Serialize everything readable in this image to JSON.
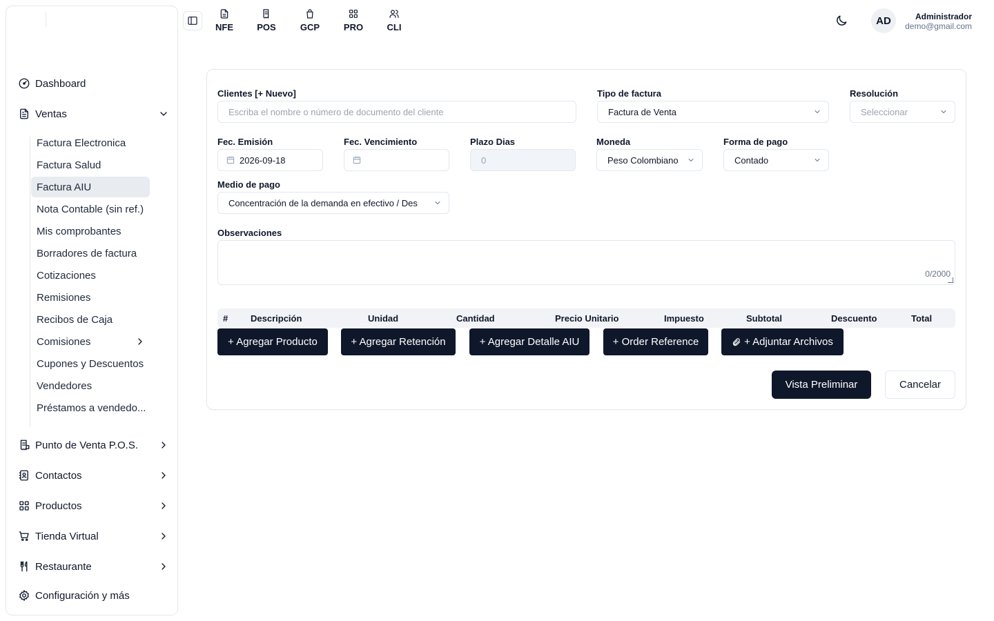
{
  "sidebar": {
    "items": [
      {
        "label": "Dashboard",
        "icon": "gauge-icon"
      },
      {
        "label": "Ventas",
        "icon": "document-icon"
      }
    ],
    "ventas_sub": [
      "Factura Electronica",
      "Factura Salud",
      "Factura AIU",
      "Nota Contable (sin ref.)",
      "Mis comprobantes",
      "Borradores de factura",
      "Cotizaciones",
      "Remisiones",
      "Recibos de Caja",
      "Comisiones",
      "Cupones y Descuentos",
      "Vendedores",
      "Préstamos a vendedo..."
    ],
    "active_sub": "Factura AIU",
    "bottom_items": [
      "Punto de Venta P.O.S.",
      "Contactos",
      "Productos",
      "Tienda Virtual",
      "Restaurante",
      "Configuración y más"
    ]
  },
  "topbar": {
    "modules": [
      "NFE",
      "POS",
      "GCP",
      "PRO",
      "CLI"
    ],
    "user_initials": "AD",
    "user_name": "Administrador",
    "user_email": "demo@gmail.com"
  },
  "form": {
    "clientes_label": "Clientes [+ Nuevo]",
    "clientes_placeholder": "Escriba el nombre o número de documento del cliente",
    "tipo_label": "Tipo de factura",
    "tipo_value": "Factura de Venta",
    "resolucion_label": "Resolución",
    "resolucion_placeholder": "Seleccionar",
    "emision_label": "Fec. Emisión",
    "emision_value": "2026-09-18",
    "vencimiento_label": "Fec. Vencimiento",
    "vencimiento_value": "",
    "plazo_label": "Plazo Dias",
    "plazo_value": "0",
    "moneda_label": "Moneda",
    "moneda_value": "Peso Colombiano",
    "forma_label": "Forma de pago",
    "forma_value": "Contado",
    "medio_label": "Medio de pago",
    "medio_value": "Concentración de la demanda en efectivo / Des",
    "obs_label": "Observaciones",
    "obs_counter": "0/2000"
  },
  "table": {
    "headers": [
      "#",
      "Descripción",
      "Unidad",
      "Cantidad",
      "Precio Unitario",
      "Impuesto",
      "Subtotal",
      "Descuento",
      "Total"
    ]
  },
  "actions": {
    "add_product": "+ Agregar Producto",
    "add_retention": "+ Agregar Retención",
    "add_aiu": "+ Agregar Detalle AIU",
    "order_ref": "+ Order Reference",
    "attach": "+ Adjuntar Archivos",
    "preview": "Vista Preliminar",
    "cancel": "Cancelar"
  },
  "colors": {
    "primary_dark": "#0f172a",
    "active_bg": "#e8ebf0",
    "border": "#e2e8f0"
  }
}
